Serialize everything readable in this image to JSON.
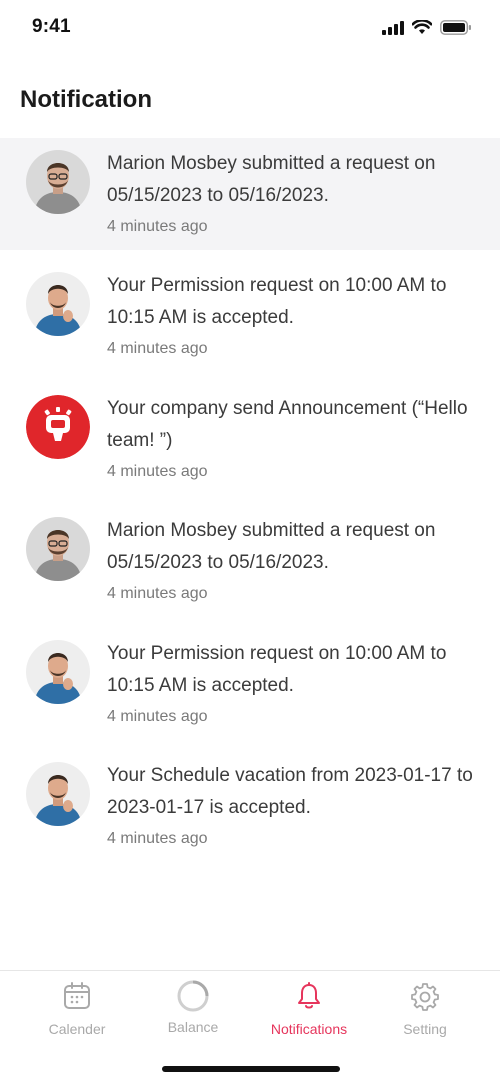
{
  "status_bar": {
    "time": "9:41"
  },
  "page": {
    "title": "Notification"
  },
  "notifications": [
    {
      "text": "Marion Mosbey submitted a request on 05/15/2023 to 05/16/2023.",
      "time": "4 minutes ago",
      "avatar": "person-grey-shirt"
    },
    {
      "text": "Your Permission request on 10:00 AM to 10:15 AM is accepted.",
      "time": "4 minutes ago",
      "avatar": "person-blue-shirt"
    },
    {
      "text": "Your company send Announcement (“Hello team! ”)",
      "time": "4 minutes ago",
      "avatar": "announcement-logo"
    },
    {
      "text": "Marion Mosbey submitted a request on 05/15/2023 to 05/16/2023.",
      "time": "4 minutes ago",
      "avatar": "person-grey-shirt"
    },
    {
      "text": "Your Permission request on 10:00 AM to 10:15 AM is accepted.",
      "time": "4 minutes ago",
      "avatar": "person-blue-shirt"
    },
    {
      "text": "Your Schedule vacation from 2023-01-17 to 2023-01-17 is accepted.",
      "time": "4 minutes ago",
      "avatar": "person-blue-shirt"
    }
  ],
  "tab_bar": {
    "tabs": [
      {
        "label": "Calender",
        "icon": "calendar-icon"
      },
      {
        "label": "Balance",
        "icon": "balance-icon"
      },
      {
        "label": "Notifications",
        "icon": "bell-icon",
        "active": true
      },
      {
        "label": "Setting",
        "icon": "gear-icon"
      }
    ]
  },
  "colors": {
    "accent": "#e6355c",
    "inactive": "#a9a9a9",
    "highlight_row": "#f4f4f6",
    "announcement": "#e0262b"
  }
}
